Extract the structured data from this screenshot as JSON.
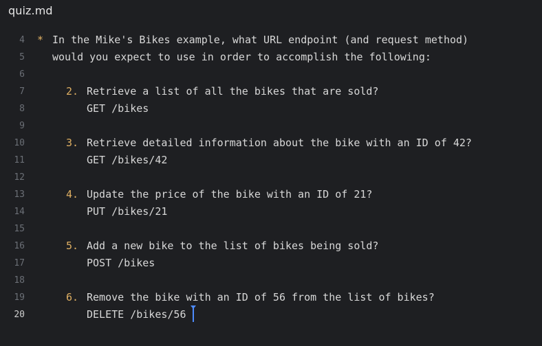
{
  "window": {
    "filename": "quiz.md"
  },
  "editor": {
    "lines": [
      {
        "number": "4",
        "bullet": "*",
        "text": "In the Mike's Bikes example, what URL endpoint (and request method)"
      },
      {
        "number": "5",
        "bullet": "",
        "text": "would you expect to use in order to accomplish the following:"
      },
      {
        "number": "6",
        "bullet": "",
        "text": ""
      },
      {
        "number": "7",
        "bullet": "2.",
        "text": "Retrieve a list of all the bikes that are sold?"
      },
      {
        "number": "8",
        "bullet": "",
        "text": "GET /bikes"
      },
      {
        "number": "9",
        "bullet": "",
        "text": ""
      },
      {
        "number": "10",
        "bullet": "3.",
        "text": "Retrieve detailed information about the bike with an ID of 42?"
      },
      {
        "number": "11",
        "bullet": "",
        "text": "GET /bikes/42"
      },
      {
        "number": "12",
        "bullet": "",
        "text": ""
      },
      {
        "number": "13",
        "bullet": "4.",
        "text": "Update the price of the bike with an ID of 21?"
      },
      {
        "number": "14",
        "bullet": "",
        "text": "PUT /bikes/21"
      },
      {
        "number": "15",
        "bullet": "",
        "text": ""
      },
      {
        "number": "16",
        "bullet": "5.",
        "text": "Add a new bike to the list of bikes being sold?"
      },
      {
        "number": "17",
        "bullet": "",
        "text": "POST /bikes"
      },
      {
        "number": "18",
        "bullet": "",
        "text": ""
      },
      {
        "number": "19",
        "bullet": "6.",
        "text": "Remove the bike with an ID of 56 from the list of bikes?"
      },
      {
        "number": "20",
        "bullet": "",
        "text": "DELETE /bikes/56"
      }
    ],
    "active_line": "20"
  },
  "colors": {
    "background": "#1e1f22",
    "text": "#d8d8d8",
    "line_number": "#6b6f76",
    "accent": "#e0b063",
    "caret": "#4e8cff"
  }
}
